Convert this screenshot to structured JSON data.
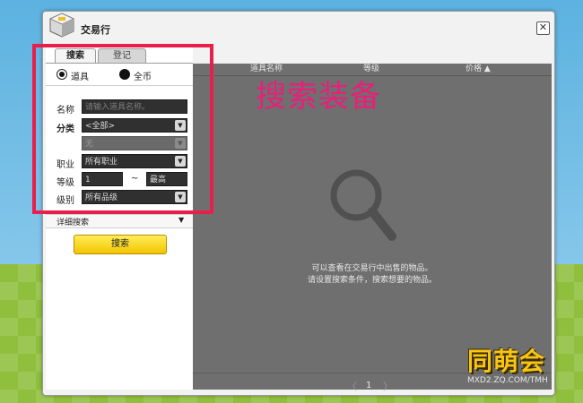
{
  "window": {
    "title": "交易行",
    "close_glyph": "✕"
  },
  "tabs": {
    "search": "搜索",
    "register": "登记"
  },
  "item_type": {
    "options": [
      "道具",
      "全币"
    ],
    "selected": "道具"
  },
  "form": {
    "name_label": "名称",
    "name_placeholder": "请输入道具名称。",
    "category_label": "分类",
    "category_value": "<全部>",
    "subcategory_value": "无",
    "job_label": "职业",
    "job_value": "所有职业",
    "level_label": "等级",
    "level_min": "1",
    "level_range_sep": "~",
    "level_max": "最高",
    "grade_label": "级别",
    "grade_value": "所有品级"
  },
  "advanced": {
    "label": "详细搜索",
    "arrow": "▼"
  },
  "search_button": "搜索",
  "results": {
    "columns": [
      "道具名称",
      "等级",
      "价格"
    ],
    "sort_indicator": "▲",
    "empty_line1": "可以查看在交易行中出售的物品。",
    "empty_line2": "请设置搜索条件，搜索想要的物品。"
  },
  "pagination": {
    "prev": "〈",
    "page": "1",
    "next": "〉"
  },
  "annotation": {
    "text": "搜索装备",
    "color": "#e81f4b"
  },
  "watermark": {
    "text": "同萌会",
    "url": "MXD2.ZQ.COM/TMH"
  },
  "icons": [
    "app-cube-icon",
    "close-icon",
    "radio-icon",
    "dropdown-arrow-icon",
    "magnifier-icon",
    "chevron-left-icon",
    "chevron-right-icon"
  ],
  "colors": {
    "accent_button": "#f2c400",
    "panel_dark": "#6f6f6f",
    "annotation": "#e81f4b"
  }
}
